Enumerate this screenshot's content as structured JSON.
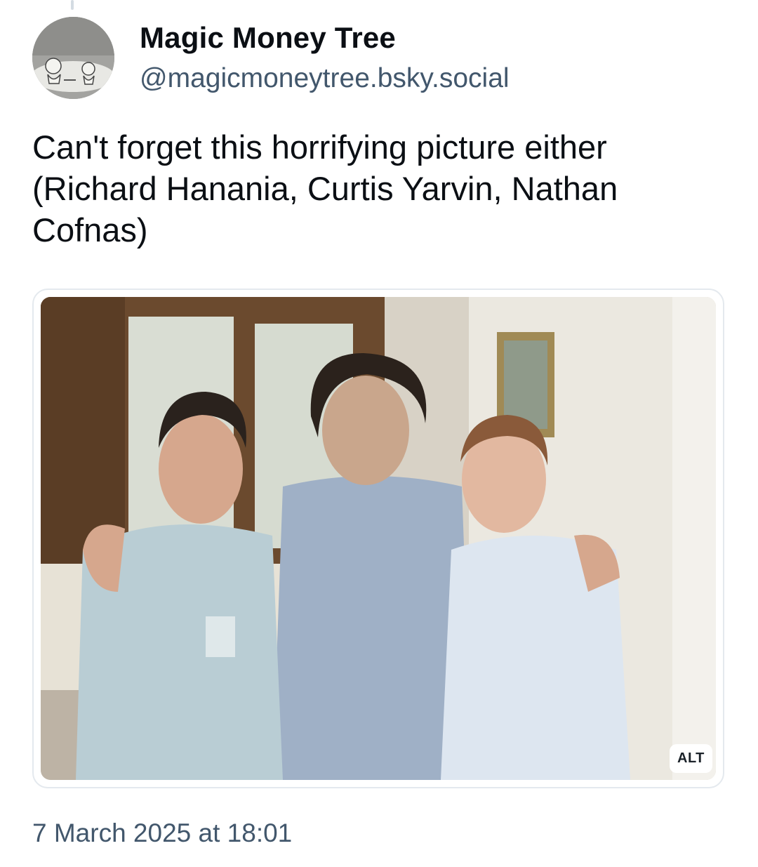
{
  "post": {
    "author": {
      "display_name": "Magic Money Tree",
      "handle": "@magicmoneytree.bsky.social",
      "avatar_icon": "avatar-image"
    },
    "text": "Can't forget this horrifying picture either (Richard Hanania, Curtis Yarvin, Nathan Cofnas)",
    "embed": {
      "alt_badge": "ALT"
    },
    "timestamp": "7 March 2025 at 18:01"
  }
}
